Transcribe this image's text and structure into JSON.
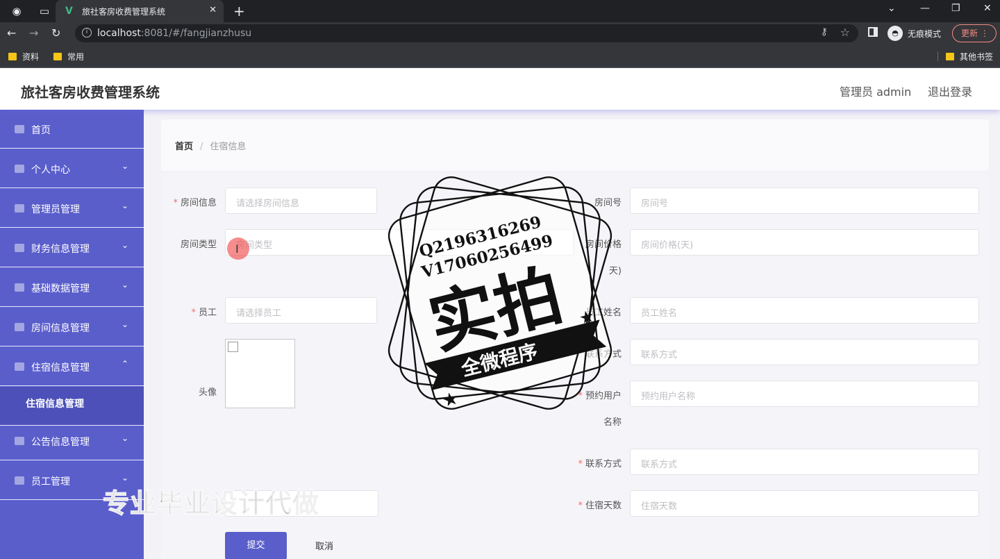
{
  "browser": {
    "tab_title": "旅社客房收费管理系统",
    "url_host": "localhost",
    "url_rest": ":8081/#/fangjianzhusu",
    "incognito_label": "无痕模式",
    "update_label": "更新",
    "bookmarks": [
      "资料",
      "常用"
    ],
    "other_bookmarks": "其他书签"
  },
  "header": {
    "title": "旅社客房收费管理系统",
    "admin": "管理员 admin",
    "logout": "退出登录"
  },
  "sidebar": {
    "items": [
      {
        "label": "首页",
        "icon": "home-icon"
      },
      {
        "label": "个人中心",
        "icon": "user-icon"
      },
      {
        "label": "管理员管理",
        "icon": "list-icon"
      },
      {
        "label": "财务信息管理",
        "icon": "finance-icon"
      },
      {
        "label": "基础数据管理",
        "icon": "database-icon"
      },
      {
        "label": "房间信息管理",
        "icon": "room-icon"
      },
      {
        "label": "住宿信息管理",
        "icon": "mail-icon"
      },
      {
        "label": "公告信息管理",
        "icon": "notice-icon"
      },
      {
        "label": "员工管理",
        "icon": "chart-icon"
      }
    ],
    "sub_item": "住宿信息管理"
  },
  "breadcrumb": {
    "home": "首页",
    "current": "住宿信息"
  },
  "form": {
    "room_info": {
      "label": "房间信息",
      "placeholder": "请选择房间信息"
    },
    "room_no": {
      "label": "房间号",
      "placeholder": "房间号"
    },
    "room_type": {
      "label": "房间类型",
      "placeholder": "房间类型"
    },
    "room_price": {
      "label": "房间价格",
      "label2": "天)",
      "placeholder": "房间价格(天)"
    },
    "staff": {
      "label": "员工",
      "placeholder": "请选择员工"
    },
    "staff_name": {
      "label": "员工姓名",
      "placeholder": "员工姓名"
    },
    "avatar": {
      "label": "头像"
    },
    "contact": {
      "label": "联系方式",
      "placeholder": "联系方式"
    },
    "booker_name": {
      "label": "预约用户",
      "label2": "名称",
      "placeholder": "预约用户名称"
    },
    "booker_contact": {
      "label": "联系方式",
      "placeholder": "联系方式"
    },
    "stay_days": {
      "label": "住宿天数",
      "placeholder": "住宿天数"
    },
    "submit": "提交",
    "cancel": "取消"
  },
  "watermark": {
    "qq": "Q2196316269",
    "v": "V17060256499",
    "big": "实拍",
    "banner": "全微程序",
    "overlay": "专业毕业设计代做"
  }
}
